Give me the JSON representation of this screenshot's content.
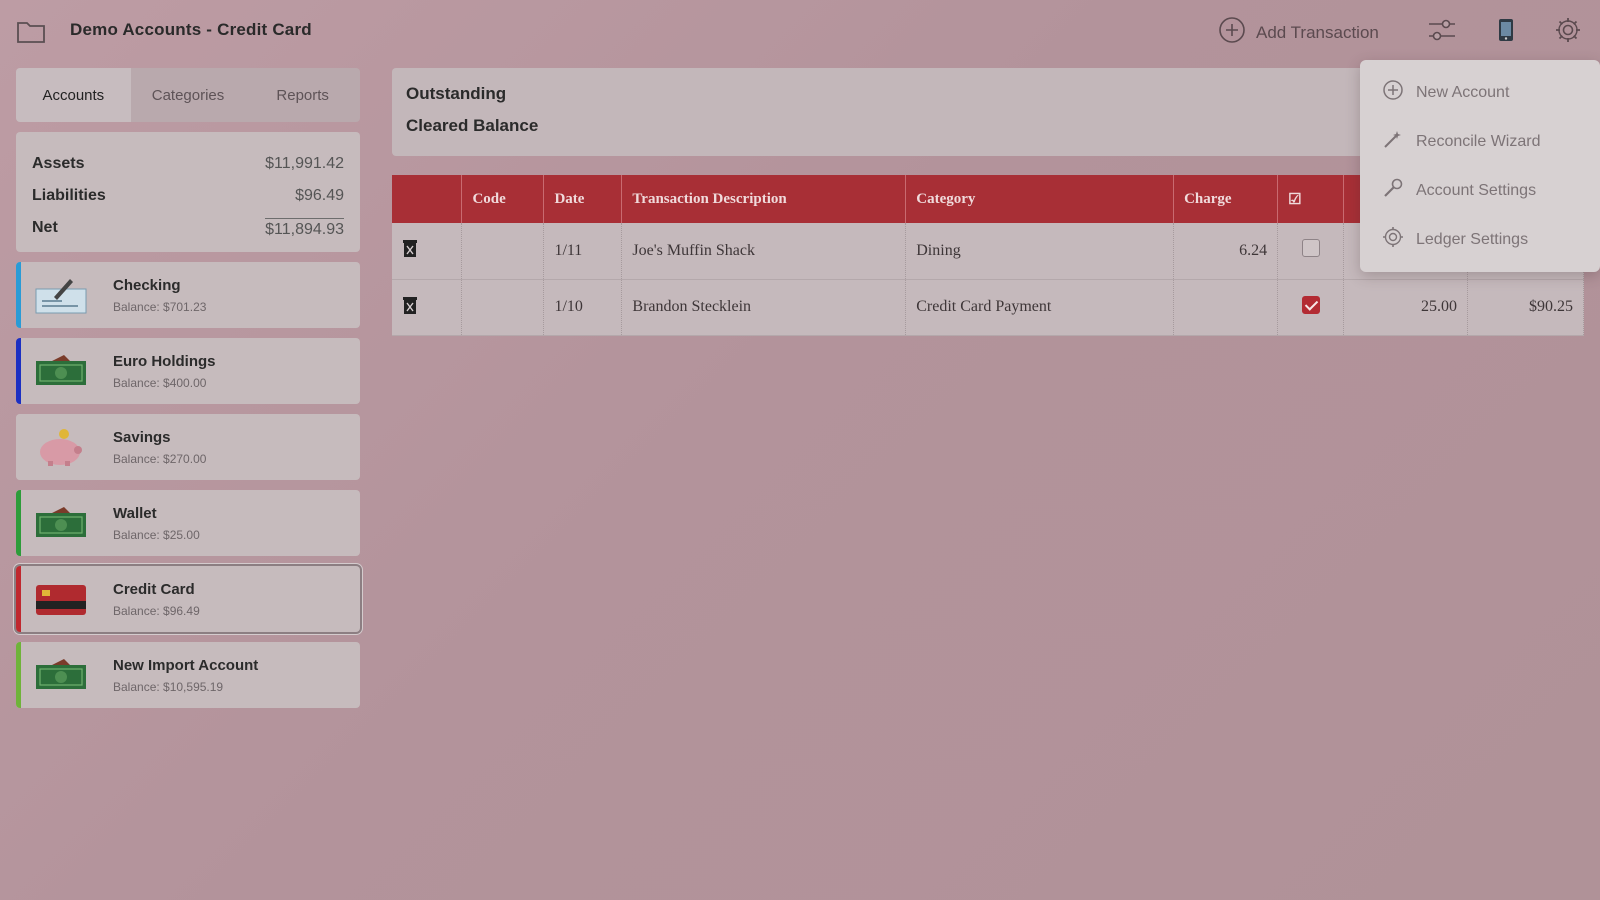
{
  "header": {
    "title": "Demo Accounts - Credit Card",
    "add_transaction_label": "Add Transaction"
  },
  "tabs": [
    "Accounts",
    "Categories",
    "Reports"
  ],
  "summary": {
    "assets_label": "Assets",
    "assets_value": "$11,991.42",
    "liabilities_label": "Liabilities",
    "liabilities_value": "$96.49",
    "net_label": "Net",
    "net_value": "$11,894.93"
  },
  "accounts": [
    {
      "name": "Checking",
      "balance": "Balance: $701.23",
      "icon": "check-icon",
      "color": "#2a9bd6"
    },
    {
      "name": "Euro Holdings",
      "balance": "Balance: $400.00",
      "icon": "cash-icon",
      "color": "#1c2fc2"
    },
    {
      "name": "Savings",
      "balance": "Balance: $270.00",
      "icon": "piggy-bank-icon",
      "color": "#c6bbbd"
    },
    {
      "name": "Wallet",
      "balance": "Balance: $25.00",
      "icon": "cash-icon",
      "color": "#2d9c3a"
    },
    {
      "name": "Credit Card",
      "balance": "Balance: $96.49",
      "icon": "credit-card-icon",
      "color": "#c0282f"
    },
    {
      "name": "New Import Account",
      "balance": "Balance: $10,595.19",
      "icon": "cash-icon",
      "color": "#6fb33a"
    }
  ],
  "main": {
    "outstanding_label": "Outstanding",
    "cleared_label": "Cleared Balance"
  },
  "table": {
    "headers": [
      "",
      "Code",
      "Date",
      "Transaction Description",
      "Category",
      "Charge",
      "☑",
      "",
      ""
    ],
    "rows": [
      {
        "code": "",
        "date": "1/11",
        "description": "Joe's Muffin Shack",
        "category": "Dining",
        "charge": "6.24",
        "cleared": false,
        "payment": "",
        "balance": ""
      },
      {
        "code": "",
        "date": "1/10",
        "description": "Brandon Stecklein",
        "category": "Credit Card Payment",
        "charge": "",
        "cleared": true,
        "payment": "25.00",
        "balance": "$90.25"
      }
    ]
  },
  "menu": {
    "items": [
      {
        "label": "New Account",
        "icon": "plus-circle-icon"
      },
      {
        "label": "Reconcile Wizard",
        "icon": "wand-icon"
      },
      {
        "label": "Account Settings",
        "icon": "wrench-icon"
      },
      {
        "label": "Ledger Settings",
        "icon": "gear-icon"
      }
    ]
  },
  "colors": {
    "accent": "#a82f36",
    "positive": "#5b8d52",
    "negative": "#b43a3f"
  }
}
